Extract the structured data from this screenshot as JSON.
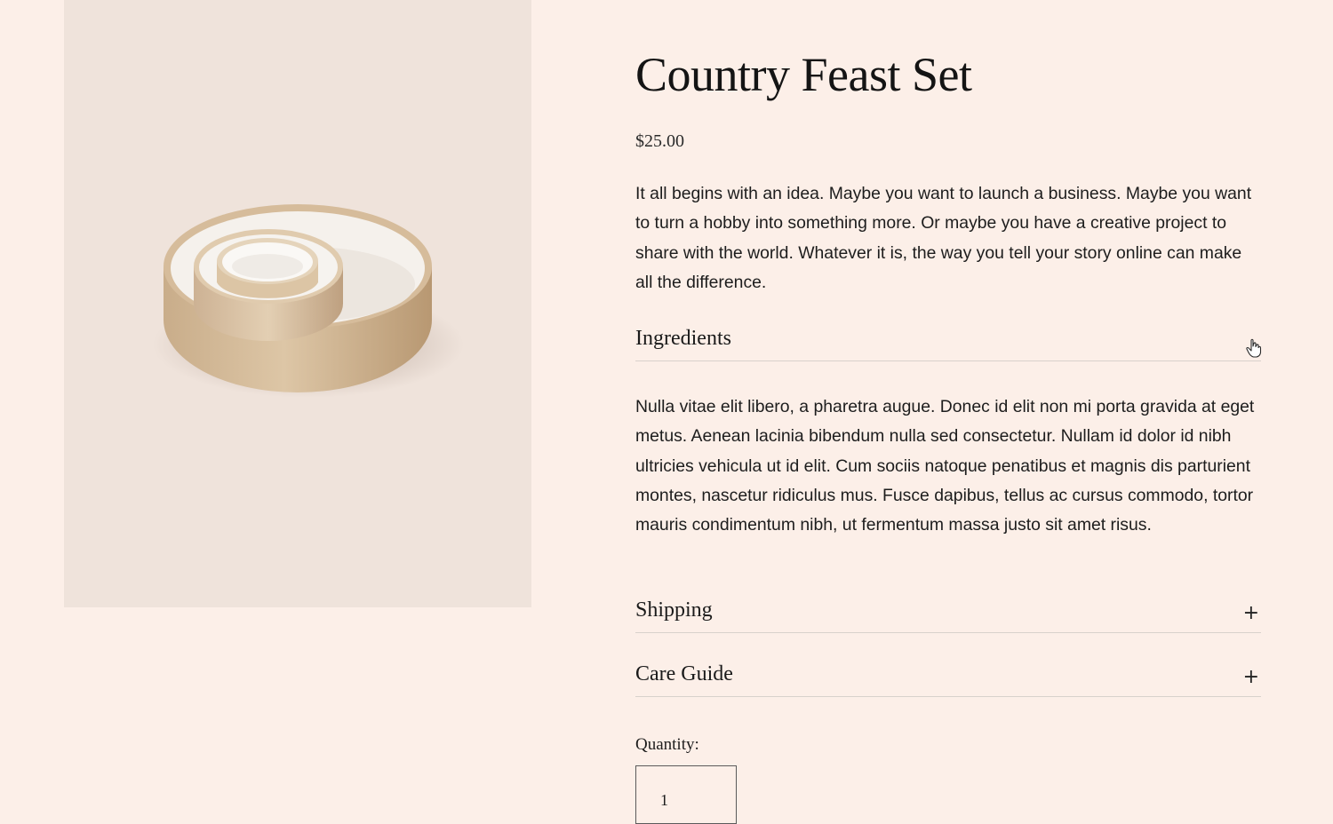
{
  "product": {
    "image_icon": "ceramic-bowl-set-photo",
    "title": "Country Feast Set",
    "price": "$25.00",
    "description": "It all begins with an idea. Maybe you want to launch a business. Maybe you want to turn a hobby into something more. Or maybe you have a creative project to share with the world. Whatever it is, the way you tell your story online can make all the difference."
  },
  "accordion": {
    "ingredients": {
      "title": "Ingredients",
      "body": "Nulla vitae elit libero, a pharetra augue. Donec id elit non mi porta gravida at eget metus. Aenean lacinia bibendum nulla sed consectetur. Nullam id dolor id nibh ultricies vehicula ut id elit. Cum sociis natoque penatibus et magnis dis parturient montes, nascetur ridiculus mus. Fusce dapibus, tellus ac cursus commodo, tortor mauris condimentum nibh, ut fermentum massa justo sit amet risus."
    },
    "shipping": {
      "title": "Shipping",
      "toggle": "+"
    },
    "care": {
      "title": "Care Guide",
      "toggle": "+"
    }
  },
  "quantity": {
    "label": "Quantity:",
    "value": "1"
  },
  "icons": {
    "cursor": "hand-pointer-icon",
    "toggle": "plus-icon"
  },
  "colors": {
    "page_background": "#fcefe8",
    "image_background": "#efe3db",
    "divider": "#d8d1cc",
    "text": "#1d1d1d"
  }
}
